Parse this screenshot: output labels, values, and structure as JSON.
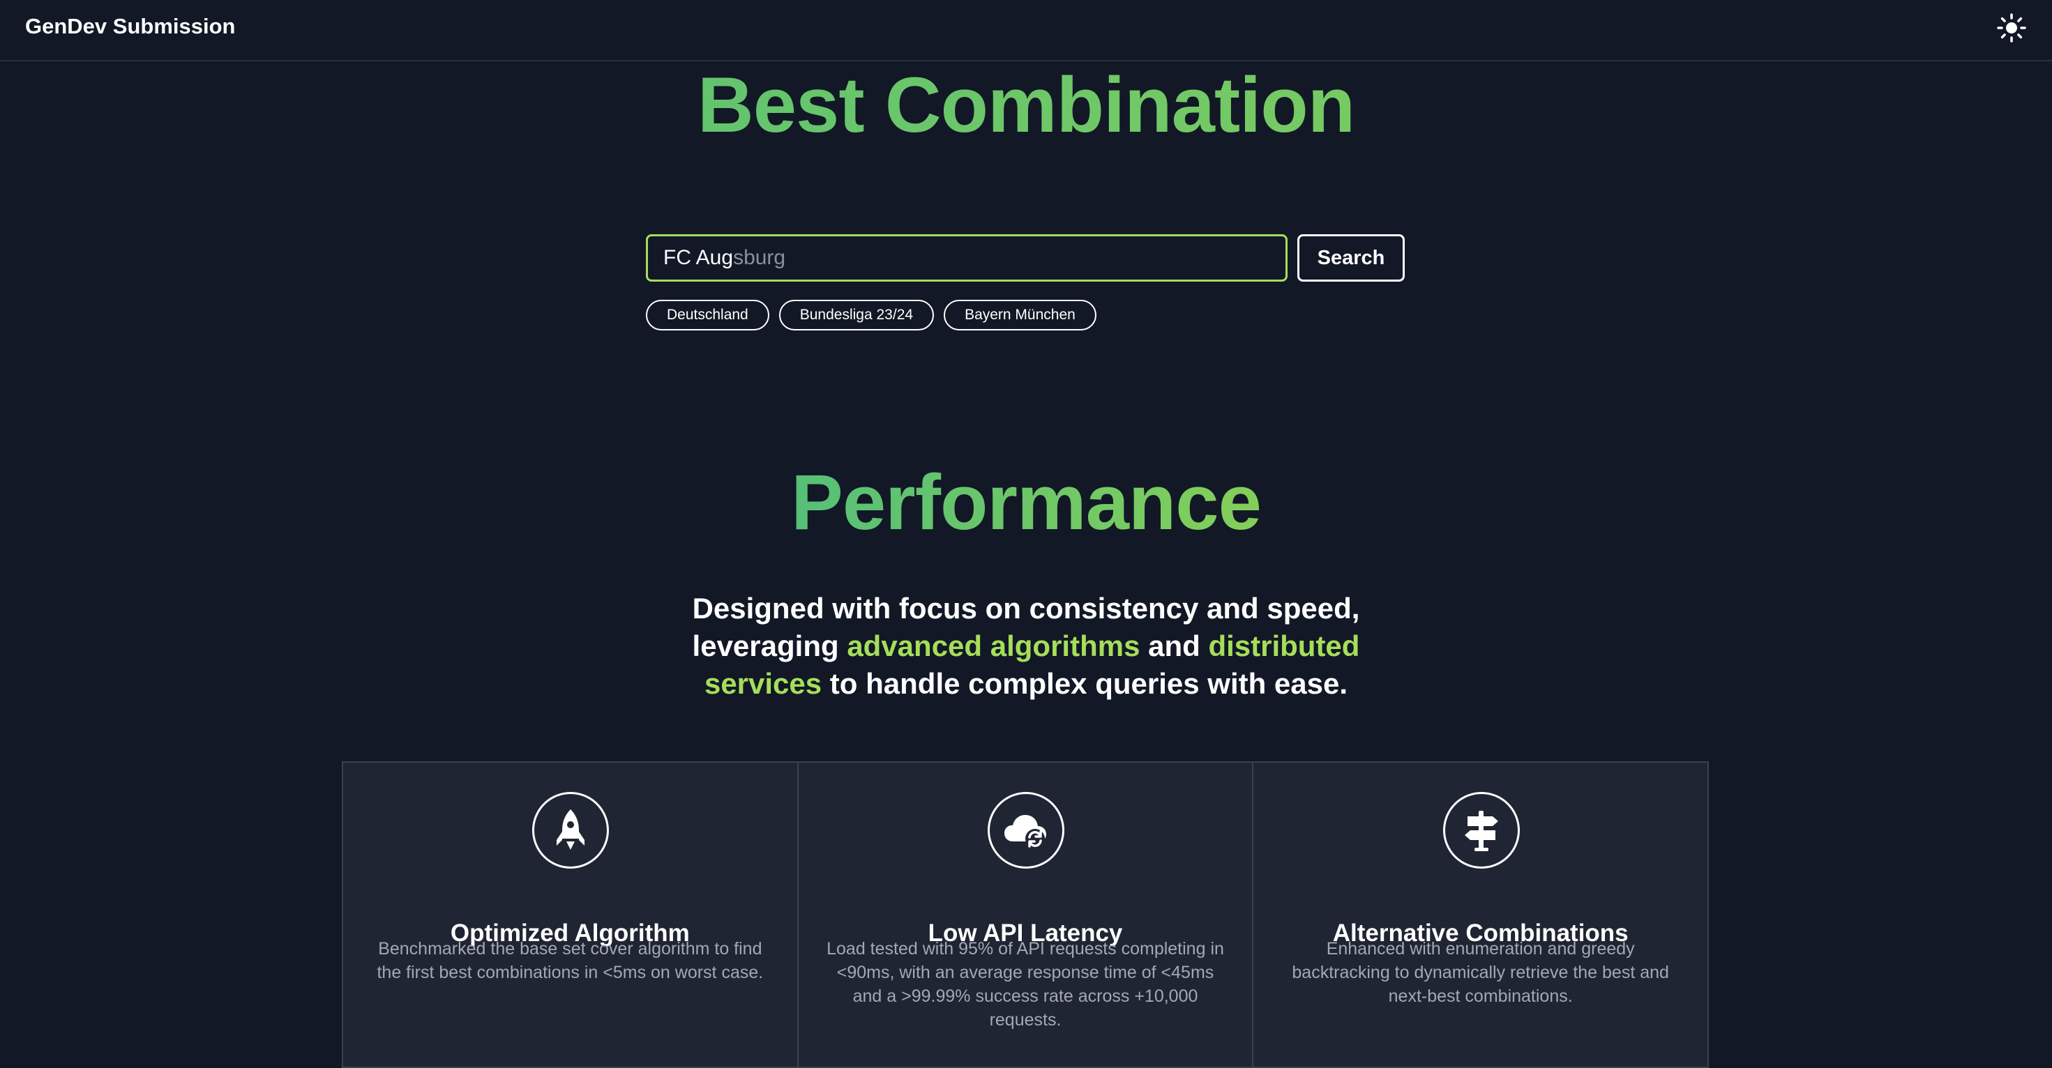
{
  "nav": {
    "brand": "GenDev Submission",
    "theme_icon": "sun-icon"
  },
  "hero": {
    "title": "Best Combination"
  },
  "search": {
    "typed": "FC Aug",
    "autocomplete": "sburg",
    "button_label": "Search"
  },
  "chips": [
    {
      "label": "Deutschland"
    },
    {
      "label": "Bundesliga 23/24"
    },
    {
      "label": "Bayern München"
    }
  ],
  "performance": {
    "title": "Performance",
    "tagline_part1": "Designed with focus on consistency and speed, leveraging ",
    "tagline_hl1": "advanced algorithms",
    "tagline_part2": " and ",
    "tagline_hl2": "distributed services",
    "tagline_part3": " to handle complex queries with ease."
  },
  "features": [
    {
      "icon": "rocket-icon",
      "title": "Optimized Algorithm",
      "description": "Benchmarked the base set cover algorithm to find the first best combinations in <5ms on worst case."
    },
    {
      "icon": "cloud-sync-icon",
      "title": "Low API Latency",
      "description": "Load tested with 95% of API requests completing in <90ms, with an average response time of <45ms and a >99.99% success rate across +10,000 requests."
    },
    {
      "icon": "signpost-icon",
      "title": "Alternative Combinations",
      "description": "Enhanced with enumeration and greedy backtracking to dynamically retrieve the best and next-best combinations."
    }
  ],
  "colors": {
    "background": "#121826",
    "accent": "#a6de5a",
    "gradient_start": "#4fbd7c",
    "gradient_end": "#8bd155",
    "card": "#1f2532"
  }
}
